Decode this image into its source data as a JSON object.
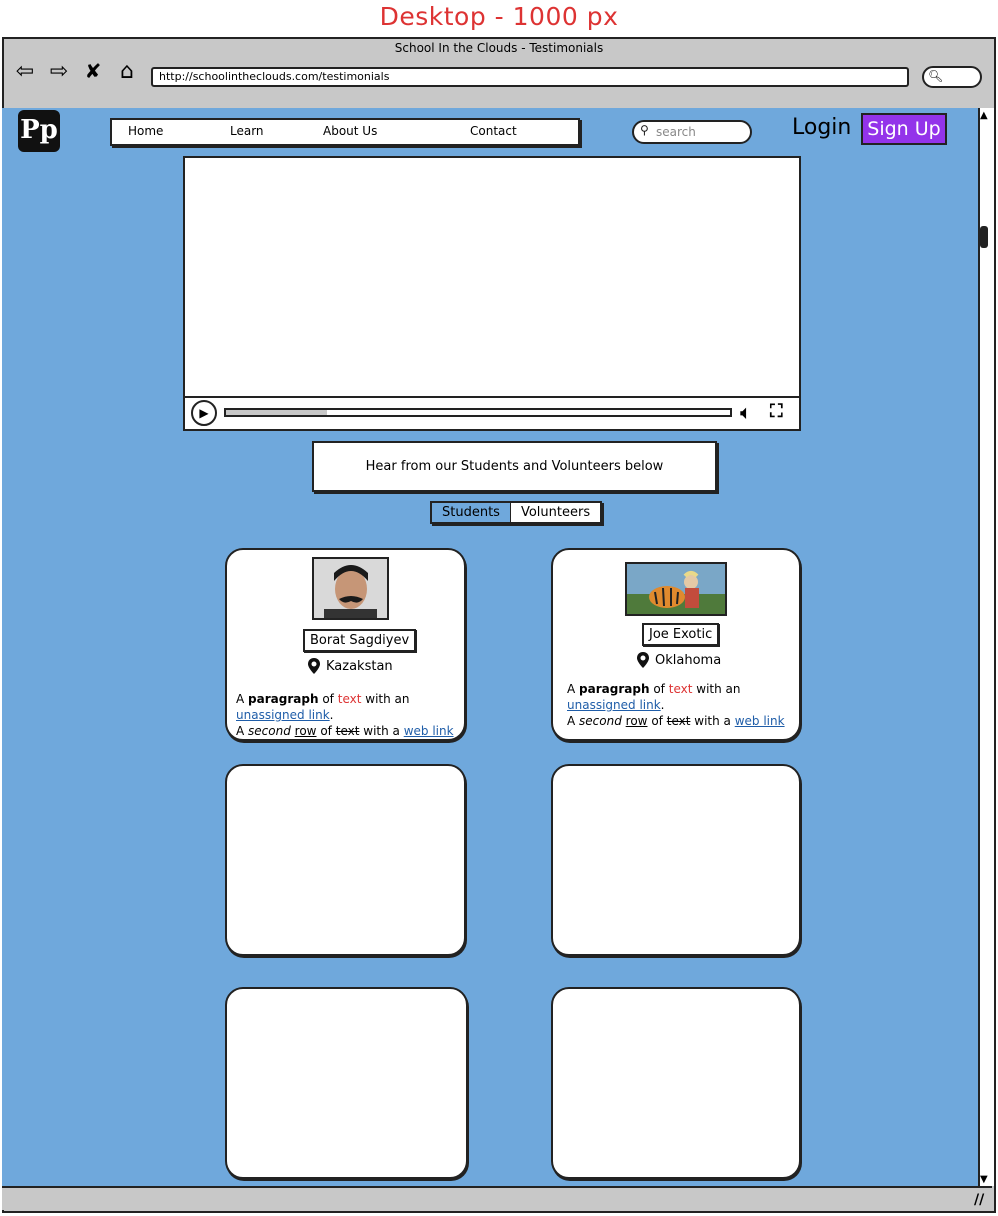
{
  "page": {
    "caption": "Desktop - 1000 px"
  },
  "browser": {
    "window_title": "School In the Clouds - Testimonials",
    "url": "http://schoolintheclouds.com/testimonials"
  },
  "site": {
    "logo_text": "Pp",
    "menu": [
      "Home",
      "Learn",
      "About Us",
      "Contact"
    ],
    "search_placeholder": "search",
    "login_label": "Login",
    "signup_label": "Sign Up",
    "signup_color": "#9333ea",
    "background_color": "#6fa8dc"
  },
  "video": {
    "progress_fraction": 0.2
  },
  "banner": {
    "text": "Hear from our Students and Volunteers below"
  },
  "tabs": {
    "students": "Students",
    "volunteers": "Volunteers",
    "active": "Students"
  },
  "testimonials": [
    {
      "name": "Borat Sagdiyev",
      "location": "Kazakstan",
      "p1": "A",
      "p1_bold": "paragraph",
      "p1_of": "of",
      "p1_red": "text",
      "p1_tail": "with an",
      "link1": "unassigned link",
      "dot": ".",
      "p2": "A",
      "p2_italic": "second",
      "p2_ul": "row",
      "p2_of": "of",
      "p2_strike": "text",
      "p2_tail": "with a",
      "link2": "web link"
    },
    {
      "name": "Joe Exotic",
      "location": "Oklahoma",
      "p1": "A",
      "p1_bold": "paragraph",
      "p1_of": "of",
      "p1_red": "text",
      "p1_tail": "with an",
      "link1": "unassigned link",
      "dot": ".",
      "p2": "A",
      "p2_italic": "second",
      "p2_ul": "row",
      "p2_of": "of",
      "p2_strike": "text",
      "p2_tail": "with a",
      "link2": "web link"
    }
  ]
}
